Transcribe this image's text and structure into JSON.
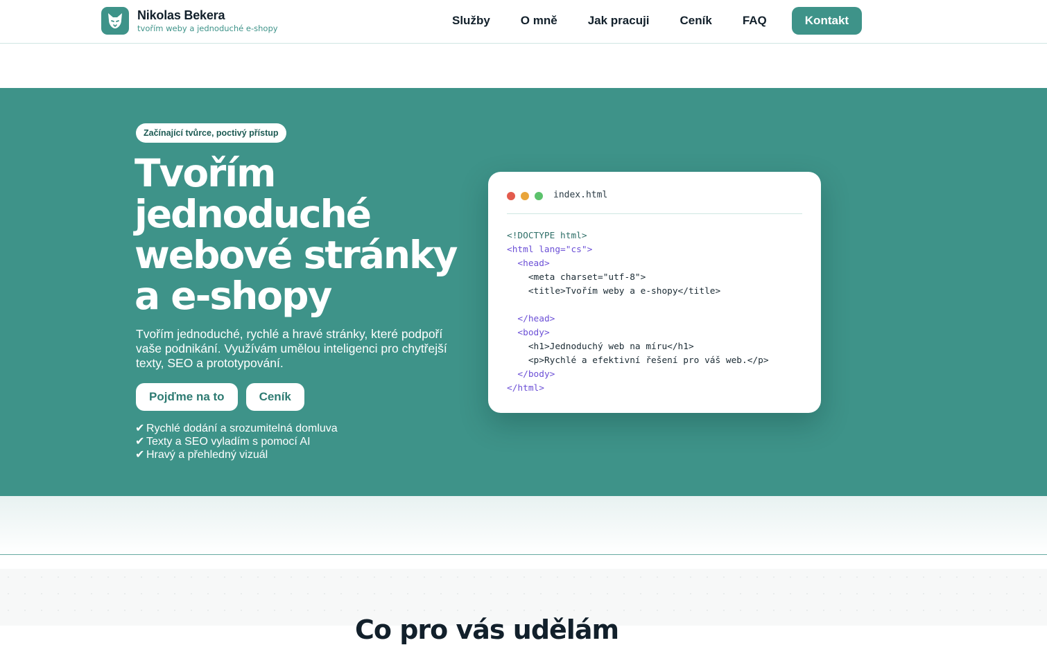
{
  "header": {
    "brand_name": "Nikolas Bekera",
    "brand_tagline": "tvořím weby a jednoduché e-shopy",
    "logo_icon": "fox-icon",
    "nav": [
      {
        "label": "Služby"
      },
      {
        "label": "O mně"
      },
      {
        "label": "Jak pracuji"
      },
      {
        "label": "Ceník"
      },
      {
        "label": "FAQ"
      }
    ],
    "cta_label": "Kontakt"
  },
  "hero": {
    "badge": "Začínající tvůrce, poctivý přístup",
    "title": "Tvořím jednoduché webové stránky a e-shopy",
    "subtitle": "Tvořím jednoduché, rychlé a hravé stránky, které podpoří vaše podnikání. Využívám umělou inteligenci pro chytřejší texty, SEO a prototypování.",
    "buttons": [
      {
        "label": "Pojďme na to"
      },
      {
        "label": "Ceník"
      }
    ],
    "checks": [
      {
        "icon": "✔",
        "text": "Rychlé dodání a srozumitelná domluva"
      },
      {
        "icon": "✔",
        "text": "Texty a SEO vyladím s pomocí AI"
      },
      {
        "icon": "✔",
        "text": "Hravý a přehledný vizuál"
      }
    ]
  },
  "code_card": {
    "filename": "index.html",
    "lines": [
      {
        "indent": "",
        "text": "<!DOCTYPE html>",
        "kind": "doctype"
      },
      {
        "indent": "",
        "text": "<html lang=\"cs\">",
        "kind": "tag"
      },
      {
        "indent": "  ",
        "text": "<head>",
        "kind": "tag"
      },
      {
        "indent": "    ",
        "text": "<meta charset=\"utf-8\">",
        "kind": "text"
      },
      {
        "indent": "    ",
        "text": "<title>Tvořím weby a e-shopy</title>",
        "kind": "text"
      },
      {
        "indent": "",
        "text": "",
        "kind": "text"
      },
      {
        "indent": "  ",
        "text": "</head>",
        "kind": "tag"
      },
      {
        "indent": "  ",
        "text": "<body>",
        "kind": "tag"
      },
      {
        "indent": "    ",
        "text": "<h1>Jednoduchý web na míru</h1>",
        "kind": "text"
      },
      {
        "indent": "    ",
        "text": "<p>Rychlé a efektivní řešení pro váš web.</p>",
        "kind": "text"
      },
      {
        "indent": "  ",
        "text": "</body>",
        "kind": "tag"
      },
      {
        "indent": "",
        "text": "</html>",
        "kind": "tag"
      }
    ]
  },
  "section": {
    "title": "Co pro vás udělám"
  },
  "colors": {
    "accent": "#3e9389",
    "code_tag": "#6b4fd6",
    "dot_red": "#e35b4d",
    "dot_yellow": "#e9a53a",
    "dot_green": "#5cc26c"
  }
}
